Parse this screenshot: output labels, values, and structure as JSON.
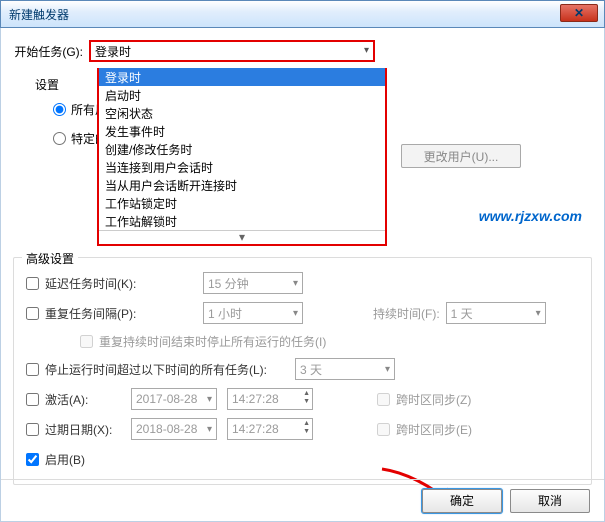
{
  "window": {
    "title": "新建触发器",
    "close": "✕"
  },
  "start": {
    "label": "开始任务(G):",
    "value": "登录时"
  },
  "dropdown": {
    "options": [
      "登录时",
      "启动时",
      "空闲状态",
      "发生事件时",
      "创建/修改任务时",
      "当连接到用户会话时",
      "当从用户会话断开连接时",
      "工作站锁定时",
      "工作站解锁时"
    ],
    "selectedIndex": 0
  },
  "settings": {
    "title": "设置",
    "allUsers": "所有用户",
    "specUser": "特定的用户",
    "changeUser": "更改用户(U)..."
  },
  "adv": {
    "title": "高级设置",
    "delay": {
      "label": "延迟任务时间(K):",
      "value": "15 分钟"
    },
    "repeat": {
      "label": "重复任务间隔(P):",
      "value": "1 小时",
      "durationLabel": "持续时间(F):",
      "durationValue": "1 天"
    },
    "stopAfterRepeat": "重复持续时间结束时停止所有运行的任务(I)",
    "stopLong": {
      "label": "停止运行时间超过以下时间的所有任务(L):",
      "value": "3 天"
    },
    "activate": {
      "label": "激活(A):",
      "date": "2017-08-28",
      "time": "14:27:28",
      "tz": "跨时区同步(Z)"
    },
    "expire": {
      "label": "过期日期(X):",
      "date": "2018-08-28",
      "time": "14:27:28",
      "tz": "跨时区同步(E)"
    },
    "enabled": "启用(B)"
  },
  "footer": {
    "ok": "确定",
    "cancel": "取消"
  },
  "watermark": "www.rjzxw.com"
}
